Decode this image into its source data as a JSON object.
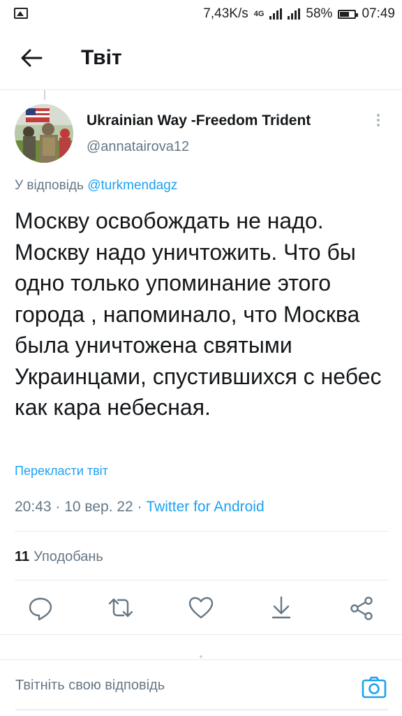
{
  "status_bar": {
    "speed": "7,43K/s",
    "network": "4G",
    "battery": "58%",
    "time": "07:49"
  },
  "header": {
    "title": "Твіт"
  },
  "tweet": {
    "author_name": "Ukrainian Way -Freedom Trident",
    "author_handle": "@annatairova12",
    "reply_prefix": "У відповідь",
    "reply_mention": "@turkmendagz",
    "text": "Москву освобождать не надо.\nМоскву надо уничтожить. Что бы одно только упоминание этого города , напоминало, что Москва была уничтожена святыми Украинцами, спустившихся с небес как кара небесная.",
    "translate_label": "Перекласти твіт",
    "time": "20:43",
    "date": "10 вер. 22",
    "source": "Twitter for Android",
    "likes_count": "11",
    "likes_label": "Уподобань"
  },
  "reply": {
    "placeholder": "Твітніть свою відповідь"
  },
  "icons": {
    "back": "arrow-left-icon",
    "more": "more-vertical-icon",
    "reply": "comment-icon",
    "retweet": "retweet-icon",
    "like": "heart-icon",
    "bookmark": "download-icon",
    "share": "share-icon",
    "camera": "camera-icon"
  },
  "colors": {
    "accent": "#1da1f2",
    "secondary_text": "#657786",
    "primary_text": "#14171a"
  }
}
